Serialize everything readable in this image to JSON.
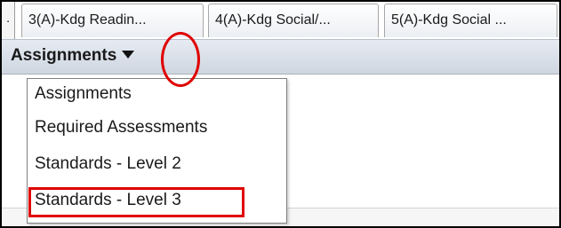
{
  "tabs": [
    {
      "label": "."
    },
    {
      "label": "3(A)-Kdg Readin..."
    },
    {
      "label": "4(A)-Kdg Social/..."
    },
    {
      "label": "5(A)-Kdg Social ..."
    }
  ],
  "header": {
    "dropdown_label": "Assignments",
    "caret_icon": "caret-down-icon"
  },
  "menu": {
    "items": [
      {
        "label": "Assignments"
      },
      {
        "label": "Required Assessments"
      },
      {
        "label": "Standards - Level 2"
      },
      {
        "label": "Standards - Level 3"
      }
    ],
    "highlighted_index": 3
  },
  "annotations": {
    "circle_color": "#e00000",
    "box_color": "#e00000"
  }
}
